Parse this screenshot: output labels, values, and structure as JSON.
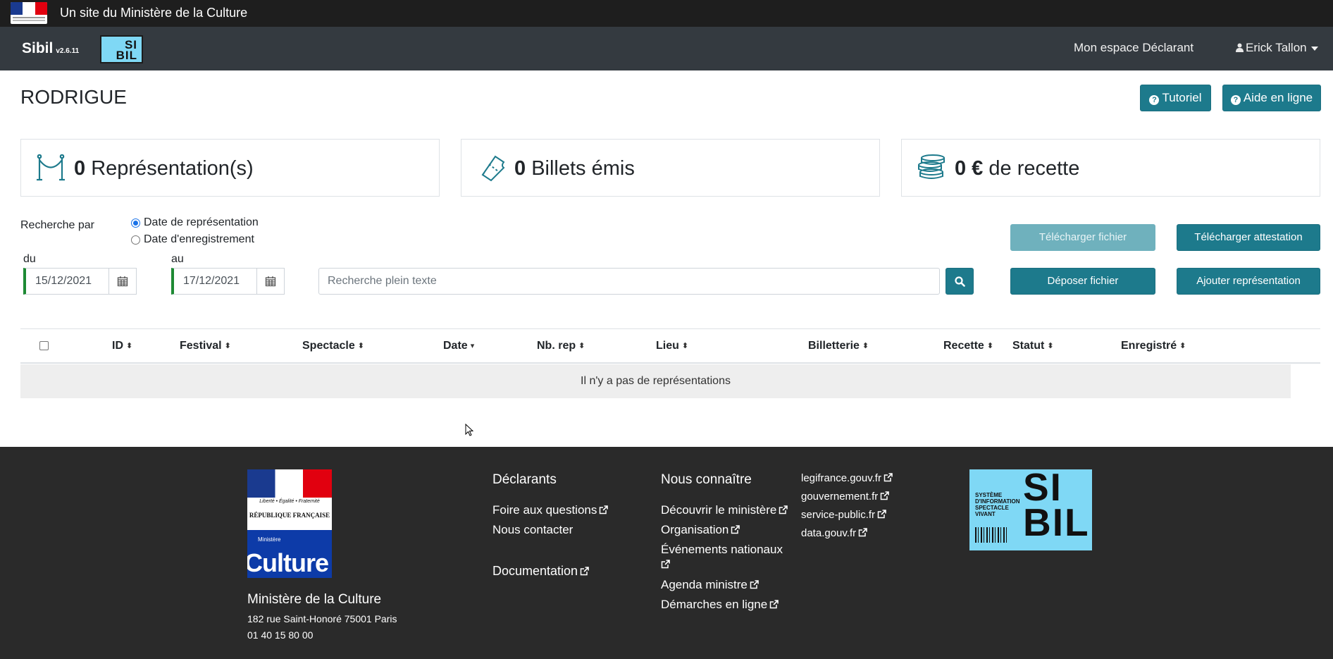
{
  "gov_banner": {
    "text": "Un site du Ministère de la Culture"
  },
  "navbar": {
    "brand": "Sibil",
    "version": "v2.6.11",
    "logo_text": "SI BIL",
    "espace_link": "Mon espace Déclarant",
    "user_name": "Erick Tallon"
  },
  "page": {
    "title": "RODRIGUE",
    "tutoriel_label": "Tutoriel",
    "aide_label": "Aide en ligne"
  },
  "stats": {
    "representations_count": "0",
    "representations_label": "Représentation(s)",
    "billets_count": "0",
    "billets_label": "Billets émis",
    "recette_count": "0 €",
    "recette_label": "de recette"
  },
  "search": {
    "label": "Recherche par",
    "option_date_rep": "Date de représentation",
    "option_date_enr": "Date d'enregistrement",
    "selected": "Date de représentation",
    "du_label": "du",
    "au_label": "au",
    "date_from": "15/12/2021",
    "date_to": "17/12/2021",
    "placeholder": "Recherche plein texte"
  },
  "actions": {
    "telecharger_fichier": "Télécharger fichier",
    "telecharger_attestation": "Télécharger attestation",
    "deposer_fichier": "Déposer fichier",
    "ajouter_representation": "Ajouter représentation"
  },
  "table": {
    "columns": [
      "ID",
      "Festival",
      "Spectacle",
      "Date",
      "Nb. rep",
      "Lieu",
      "Billetterie",
      "Recette",
      "Statut",
      "Enregistré"
    ],
    "empty_message": "Il n'y a pas de représentations"
  },
  "footer": {
    "marianne_devise": "Liberté • Égalité • Fraternité",
    "marianne_rf": "RÉPUBLIQUE FRANÇAISE",
    "marianne_ministere": "Ministère",
    "marianne_culture": "Culture",
    "ministry_name": "Ministère de la Culture",
    "address": "182 rue Saint-Honoré 75001 Paris",
    "phone": "01 40 15 80 00",
    "declarants": {
      "heading": "Déclarants",
      "faq": "Foire aux questions",
      "contact": "Nous contacter",
      "documentation": "Documentation"
    },
    "connaitre": {
      "heading": "Nous connaître",
      "links": [
        "Découvrir le ministère",
        "Organisation",
        "Événements nationaux",
        "Agenda ministre",
        "Démarches en ligne"
      ]
    },
    "sites": [
      "legifrance.gouv.fr",
      "gouvernement.fr",
      "service-public.fr",
      "data.gouv.fr"
    ],
    "sibil_small": "SYSTÈME D'INFORMATION SPECTACLE VIVANT",
    "sibil_big": "SI BIL"
  },
  "icons": {
    "accent": "#1d7a8c",
    "stat_icon_color": "#1d7a8c"
  }
}
